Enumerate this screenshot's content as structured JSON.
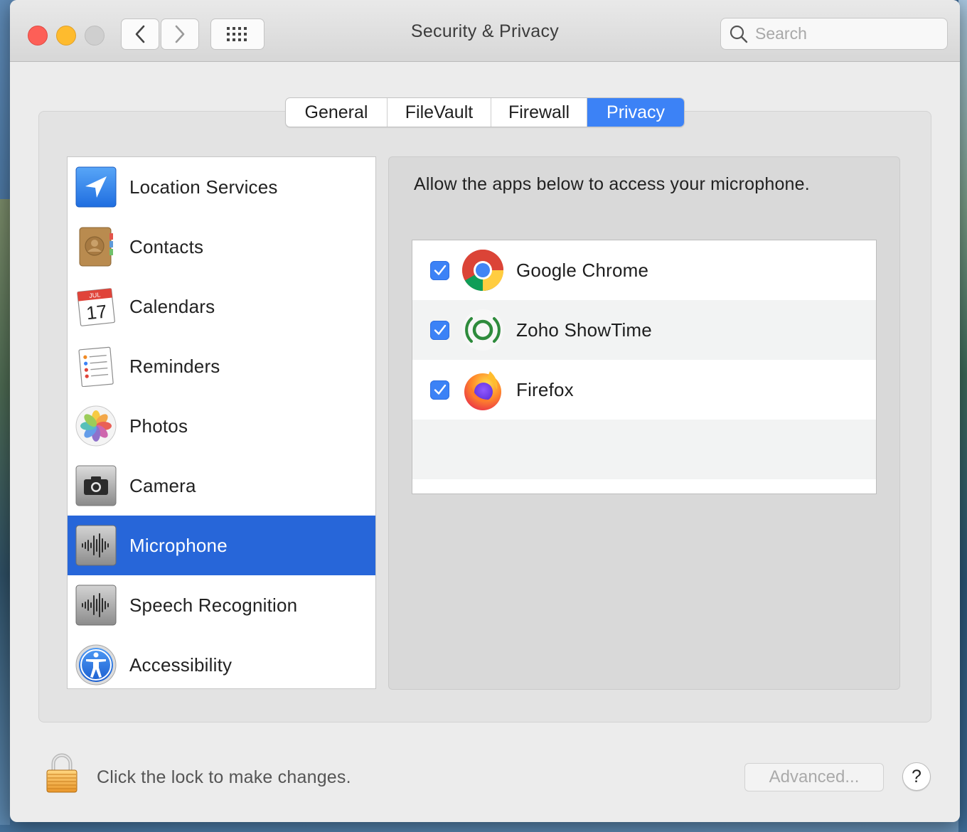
{
  "window": {
    "title": "Security & Privacy"
  },
  "search": {
    "placeholder": "Search",
    "value": ""
  },
  "tabs": [
    {
      "label": "General",
      "active": false
    },
    {
      "label": "FileVault",
      "active": false
    },
    {
      "label": "Firewall",
      "active": false
    },
    {
      "label": "Privacy",
      "active": true
    }
  ],
  "sidebar": {
    "items": [
      {
        "label": "Location Services",
        "icon": "location-arrow-icon",
        "selected": false
      },
      {
        "label": "Contacts",
        "icon": "contacts-book-icon",
        "selected": false
      },
      {
        "label": "Calendars",
        "icon": "calendar-icon",
        "calendar_month": "JUL",
        "calendar_day": "17",
        "selected": false
      },
      {
        "label": "Reminders",
        "icon": "reminders-list-icon",
        "selected": false
      },
      {
        "label": "Photos",
        "icon": "photos-flower-icon",
        "selected": false
      },
      {
        "label": "Camera",
        "icon": "camera-icon",
        "selected": false
      },
      {
        "label": "Microphone",
        "icon": "microphone-waveform-icon",
        "selected": true
      },
      {
        "label": "Speech Recognition",
        "icon": "speech-waveform-icon",
        "selected": false
      },
      {
        "label": "Accessibility",
        "icon": "accessibility-figure-icon",
        "selected": false
      }
    ]
  },
  "panel": {
    "description": "Allow the apps below to access your microphone.",
    "apps": [
      {
        "name": "Google Chrome",
        "icon": "google-chrome-icon",
        "checked": true
      },
      {
        "name": "Zoho ShowTime",
        "icon": "zoho-showtime-icon",
        "checked": true
      },
      {
        "name": "Firefox",
        "icon": "firefox-icon",
        "checked": true
      }
    ]
  },
  "footer": {
    "lock_text": "Click the lock to make changes.",
    "advanced_label": "Advanced...",
    "help_label": "?"
  },
  "colors": {
    "accent": "#3c82f6",
    "selection": "#2766d9",
    "close": "#fd5f57",
    "minimize": "#febb2e"
  }
}
